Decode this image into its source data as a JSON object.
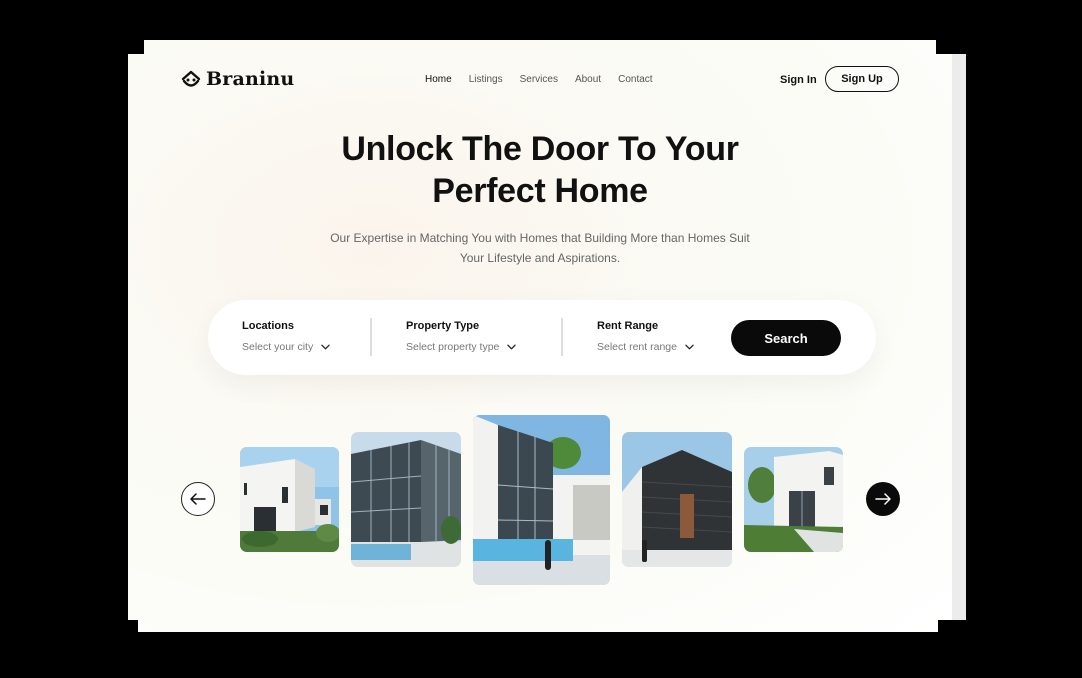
{
  "brand": {
    "name": "Braninu",
    "icon": "smile-house-logo-icon"
  },
  "nav": {
    "items": [
      {
        "label": "Home",
        "active": true
      },
      {
        "label": "Listings",
        "active": false
      },
      {
        "label": "Services",
        "active": false
      },
      {
        "label": "About",
        "active": false
      },
      {
        "label": "Contact",
        "active": false
      }
    ]
  },
  "auth": {
    "signin_label": "Sign In",
    "signup_label": "Sign Up"
  },
  "hero": {
    "title_line1": "Unlock The Door To Your",
    "title_line2": "Perfect Home",
    "subtitle_line1": "Our Expertise in Matching You with Homes that Building More than Homes Suit",
    "subtitle_line2": "Your Lifestyle and Aspirations."
  },
  "search": {
    "fields": [
      {
        "label": "Locations",
        "placeholder": "Select your city"
      },
      {
        "label": "Property Type",
        "placeholder": "Select property type"
      },
      {
        "label": "Rent Range",
        "placeholder": "Select rent range"
      }
    ],
    "button_label": "Search"
  },
  "carousel": {
    "prev_icon": "arrow-left-icon",
    "next_icon": "arrow-right-icon",
    "slides": [
      {
        "name": "white-modern-villa"
      },
      {
        "name": "glass-cube-house-with-pool"
      },
      {
        "name": "glass-house-featured"
      },
      {
        "name": "dark-clad-house"
      },
      {
        "name": "white-house-with-lawn"
      }
    ]
  },
  "colors": {
    "accent": "#0a0a0a",
    "text": "#111111",
    "muted": "#666666",
    "background": "#fbfbf6"
  }
}
